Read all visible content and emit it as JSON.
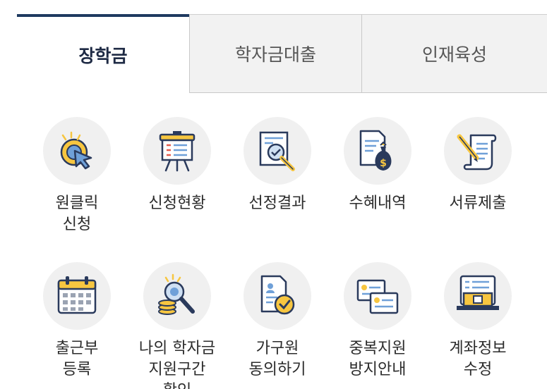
{
  "tabs": [
    {
      "label": "장학금",
      "active": true
    },
    {
      "label": "학자금대출",
      "active": false
    },
    {
      "label": "인재육성",
      "active": false
    }
  ],
  "menu": [
    {
      "icon": "cursor-click-icon",
      "lines": [
        "원클릭",
        "신청"
      ]
    },
    {
      "icon": "presentation-board-icon",
      "lines": [
        "신청현황"
      ]
    },
    {
      "icon": "document-magnifier-icon",
      "lines": [
        "선정결과"
      ]
    },
    {
      "icon": "money-bag-document-icon",
      "lines": [
        "수혜내역"
      ]
    },
    {
      "icon": "scroll-pen-icon",
      "lines": [
        "서류제출"
      ]
    },
    {
      "icon": "calendar-icon",
      "lines": [
        "출근부",
        "등록"
      ]
    },
    {
      "icon": "coins-magnifier-icon",
      "lines": [
        "나의 학자금",
        "지원구간",
        "확인"
      ]
    },
    {
      "icon": "document-check-icon",
      "lines": [
        "가구원",
        "동의하기"
      ]
    },
    {
      "icon": "duplicate-cards-icon",
      "lines": [
        "중복지원",
        "방지안내"
      ]
    },
    {
      "icon": "bank-account-icon",
      "lines": [
        "계좌정보",
        "수정"
      ]
    }
  ],
  "colors": {
    "accent": "#1f3a60",
    "icon_navy": "#2a3a5c",
    "icon_yellow": "#f7c640",
    "icon_blue": "#6fa0d8"
  }
}
